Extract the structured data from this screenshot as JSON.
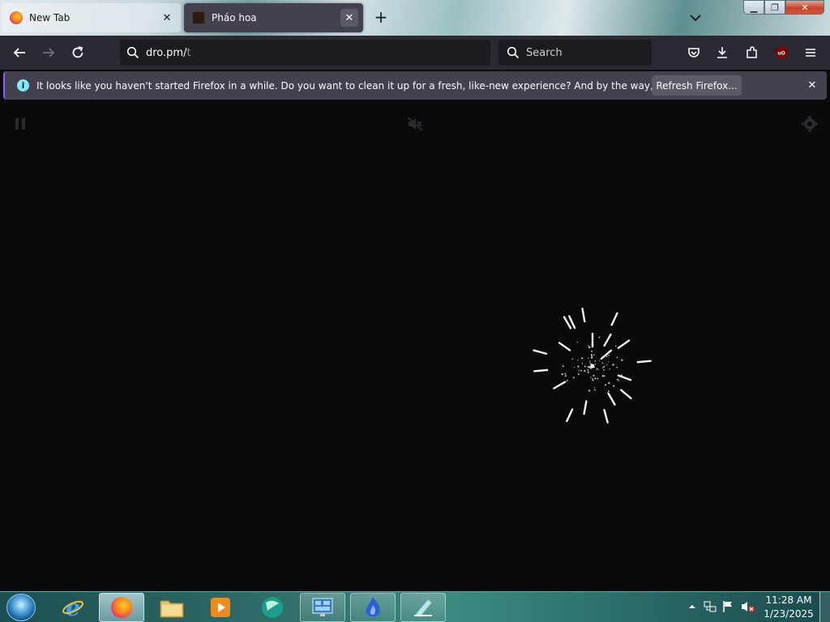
{
  "tabs": [
    {
      "title": "New Tab",
      "favicon": "firefox-icon",
      "active": false
    },
    {
      "title": "Pháo hoa",
      "favicon": "site-favicon",
      "active": true
    }
  ],
  "window_controls": {
    "minimize": "minimize-icon",
    "maximize": "maximize-icon",
    "close": "close-icon"
  },
  "navbar": {
    "url_host": "dro.pm/",
    "url_cursor": "t",
    "search_placeholder": "Search"
  },
  "notification": {
    "message": "It looks like you haven't started Firefox in a while. Do you want to clean it up for a fresh, like-new experience? And by the way, welcome back!",
    "button_label": "Refresh Firefox..."
  },
  "clock": {
    "time": "11:28 AM",
    "date": "1/23/2025"
  },
  "colors": {
    "firefox_dark": "#2b2a33",
    "urlbar": "#1c1b22",
    "notification_bg": "#42414d",
    "page_bg": "#0a090b",
    "taskbar": "#2d6a66"
  }
}
